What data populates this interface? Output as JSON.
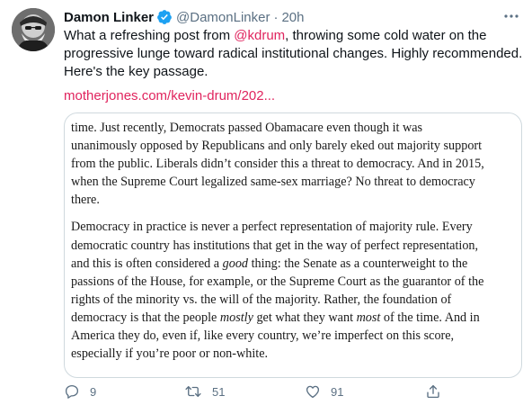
{
  "author": {
    "name": "Damon Linker",
    "handle": "@DamonLinker",
    "separator": "·",
    "time": "20h"
  },
  "body": {
    "line1_prefix": "What a refreshing post from ",
    "mention": "@kdrum",
    "line1_suffix": ", throwing some cold water on the",
    "line2": "progressive lunge toward radical institutional changes. Highly recommended.",
    "line3": "Here's the key passage."
  },
  "link_text": "motherjones.com/kevin-drum/202...",
  "excerpt": {
    "p1": [
      "time. Just recently, Democrats passed Obamacare even though it was",
      "unanimously opposed by Republicans and only barely eked out majority support",
      "from the public. Liberals didn’t consider this a threat to democracy. And in 2015,",
      "when the Supreme Court legalized same-sex marriage? No threat to democracy",
      "there."
    ],
    "p2_l1": "Democracy in practice is never a perfect representation of majority rule. Every",
    "p2_l2": "democratic country has institutions that get in the way of perfect representation,",
    "p2_l3_a": "and this is often considered a ",
    "p2_l3_em": "good",
    "p2_l3_b": " thing: the Senate as a counterweight to the",
    "p2_l4": "passions of the House, for example, or the Supreme Court as the guarantor of the",
    "p2_l5": "rights of the minority vs. the will of the majority. Rather, the foundation of",
    "p2_l6_a": "democracy is that the people ",
    "p2_l6_em1": "mostly",
    "p2_l6_b": " get what they want ",
    "p2_l6_em2": "most",
    "p2_l6_c": " of the time. And in",
    "p2_l7": "America they do, even if, like every country, we’re imperfect on this score,",
    "p2_l8": "especially if you’re poor or non-white."
  },
  "actions": {
    "reply_count": "9",
    "retweet_count": "51",
    "like_count": "91"
  },
  "icons": {
    "reply": "reply-icon",
    "retweet": "retweet-icon",
    "like": "like-icon",
    "share": "share-icon",
    "more": "more-icon",
    "verified": "verified-badge-icon"
  },
  "colors": {
    "accent": "#e0245e",
    "secondary_text": "#5b7083",
    "verified": "#1da1f2"
  }
}
